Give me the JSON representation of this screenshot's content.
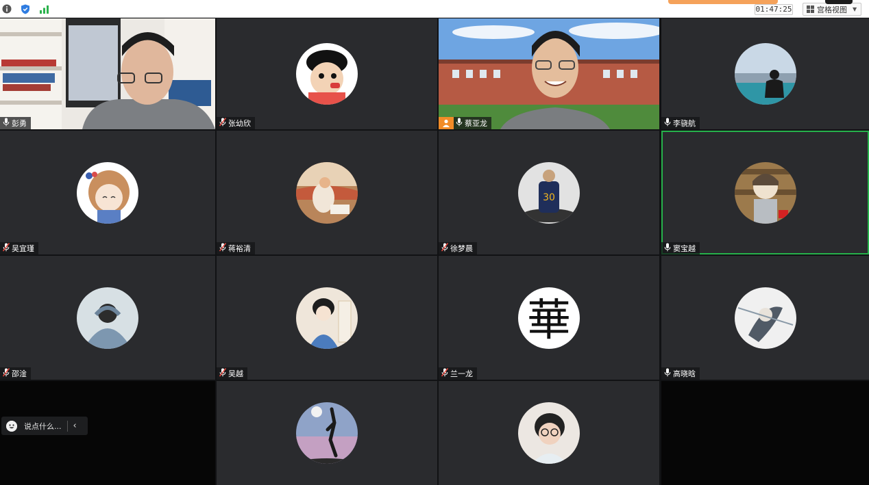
{
  "toolbar": {
    "timer": "01:47:25",
    "view_label": "宫格视图",
    "view_dropdown_icon": "caret-down-icon",
    "icons": [
      "info-icon",
      "shield-icon",
      "signal-icon",
      "grid-icon"
    ]
  },
  "participants": [
    {
      "name": "彭勇",
      "mic": "unmuted",
      "media": "video"
    },
    {
      "name": "张幼欣",
      "mic": "muted",
      "media": "avatar-cartoon-boy"
    },
    {
      "name": "蔡亚龙",
      "mic": "unmuted",
      "media": "video",
      "host": true
    },
    {
      "name": "李骁航",
      "mic": "unmuted",
      "media": "avatar-lake"
    },
    {
      "name": "吴宜瑾",
      "mic": "muted",
      "media": "avatar-anime-girl"
    },
    {
      "name": "蒋裕清",
      "mic": "muted",
      "media": "avatar-painting"
    },
    {
      "name": "徐梦晨",
      "mic": "muted",
      "media": "avatar-jersey"
    },
    {
      "name": "窦宝越",
      "mic": "unmuted",
      "media": "avatar-library",
      "active_speaker": true
    },
    {
      "name": "邵淦",
      "mic": "muted",
      "media": "avatar-hoodie"
    },
    {
      "name": "吴越",
      "mic": "muted",
      "media": "avatar-hanfu"
    },
    {
      "name": "兰一龙",
      "mic": "muted",
      "media": "avatar-calligraphy"
    },
    {
      "name": "高晓晗",
      "mic": "unmuted",
      "media": "avatar-swordsman"
    },
    {
      "name": "",
      "mic": "none",
      "media": "empty"
    },
    {
      "name": "",
      "mic": "none",
      "media": "avatar-basketball"
    },
    {
      "name": "",
      "mic": "none",
      "media": "avatar-glasses-woman"
    },
    {
      "name": "",
      "mic": "none",
      "media": "empty"
    }
  ],
  "chat": {
    "placeholder": "说点什么...",
    "emoji_icon": "emoji-icon",
    "collapse_icon": "chevron-left-icon"
  },
  "colors": {
    "tile_bg": "#2a2b2e",
    "active_speaker_border": "#26b24b",
    "host_badge": "#f28c28",
    "muted_mic": "#e0473d"
  }
}
